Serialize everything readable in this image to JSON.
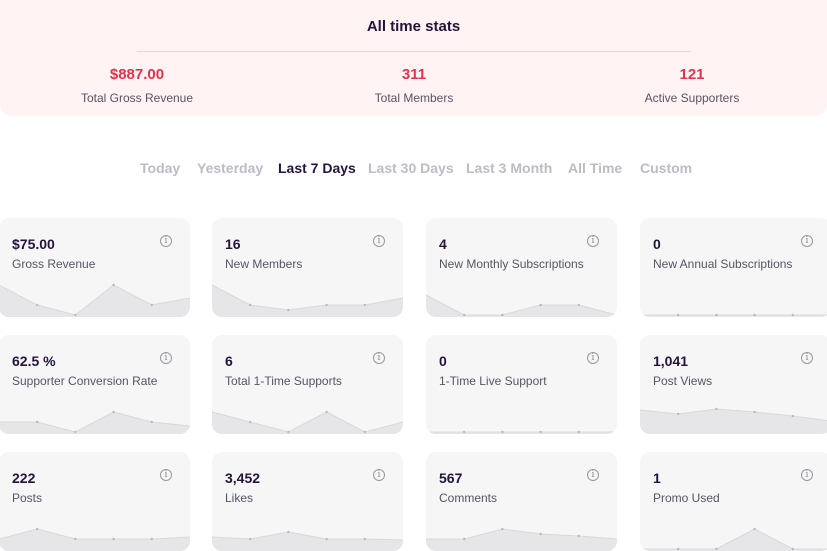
{
  "all_time": {
    "title": "All time stats",
    "stats": [
      {
        "value": "$887.00",
        "label": "Total Gross Revenue"
      },
      {
        "value": "311",
        "label": "Total Members"
      },
      {
        "value": "121",
        "label": "Active Supporters"
      }
    ]
  },
  "tabs": [
    {
      "label": "Today",
      "active": false
    },
    {
      "label": "Yesterday",
      "active": false
    },
    {
      "label": "Last 7 Days",
      "active": true
    },
    {
      "label": "Last 30 Days",
      "active": false
    },
    {
      "label": "Last 3 Month",
      "active": false
    },
    {
      "label": "All Time",
      "active": false
    },
    {
      "label": "Custom",
      "active": false
    }
  ],
  "cards": [
    {
      "value": "$75.00",
      "label": "Gross Revenue",
      "spark": [
        3,
        1,
        0,
        3,
        1,
        1.7
      ]
    },
    {
      "value": "16",
      "label": "New Members",
      "spark": [
        3,
        1,
        0.5,
        1,
        1,
        1.7
      ]
    },
    {
      "value": "4",
      "label": "New Monthly Subscriptions",
      "spark": [
        2,
        0,
        0,
        1,
        1,
        0
      ]
    },
    {
      "value": "0",
      "label": "New Annual Subscriptions",
      "spark": [
        0,
        0,
        0,
        0,
        0,
        0
      ]
    },
    {
      "value": "62.5 %",
      "label": "Supporter Conversion Rate",
      "spark": [
        1,
        1,
        0,
        2,
        1,
        0.6
      ]
    },
    {
      "value": "6",
      "label": "Total 1-Time Supports",
      "spark": [
        2,
        1,
        0,
        2,
        0,
        1
      ]
    },
    {
      "value": "0",
      "label": "1-Time Live Support",
      "spark": [
        0,
        0,
        0,
        0,
        0,
        0
      ]
    },
    {
      "value": "1,041",
      "label": "Post Views",
      "spark": [
        2.2,
        1.8,
        2.3,
        2,
        1.6,
        1.1
      ]
    },
    {
      "value": "222",
      "label": "Posts",
      "spark": [
        1,
        2,
        1,
        1,
        1,
        1.2
      ]
    },
    {
      "value": "3,452",
      "label": "Likes",
      "spark": [
        1.2,
        1,
        1.7,
        1,
        1,
        0.9
      ]
    },
    {
      "value": "567",
      "label": "Comments",
      "spark": [
        1,
        1,
        2,
        1.5,
        1.3,
        1
      ]
    },
    {
      "value": "1",
      "label": "Promo Used",
      "spark": [
        0,
        0,
        0,
        2,
        0,
        0
      ]
    }
  ],
  "icons": {
    "info": "info-circle-icon"
  },
  "colors": {
    "accent": "#e0334f",
    "dark_text": "#24143a",
    "muted_tab": "#bfbac6",
    "card_bg": "#f6f6f7",
    "banner_bg": "#fff3f4"
  }
}
